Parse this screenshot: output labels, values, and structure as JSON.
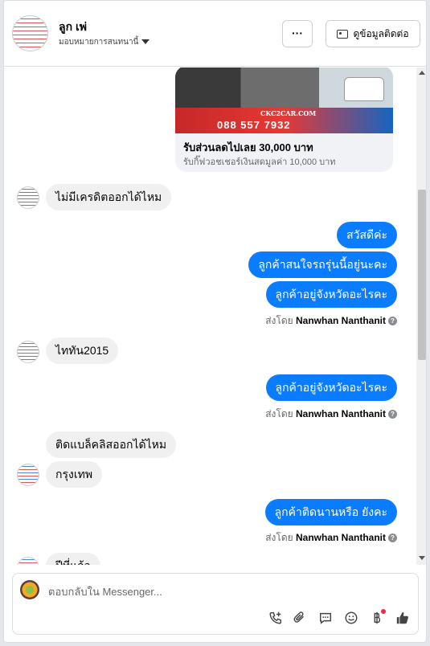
{
  "header": {
    "contact_name": "ลูก เพ่",
    "assign_label": "มอบหมายการสนทนานี้",
    "more_label": "···",
    "contact_info_label": "ดูข้อมูลติดต่อ"
  },
  "ad_card": {
    "site_text": "CKC2CAR.COM",
    "phone_text": "088 557 7932",
    "title": "รับส่วนลดไปเลย 30,000 บาท",
    "subtitle": "รับกิ๊ฟวอชเชอร์เงินสดมูลค่า 10,000 บาท"
  },
  "messages": {
    "m1": "ไม่มีเครดิตออกได้ไหม",
    "m2": "สวัสดีค่ะ",
    "m3": "ลูกค้าสนใจรถรุ่นนี้อยู่นะคะ",
    "m4": "ลูกค้าอยู่จังหวัดอะไรคะ",
    "m5": "ไททัน2015",
    "m6": "ลูกค้าอยู่จังหวัดอะไรคะ",
    "m7": "ติดแบล็คลิสออกได้ไหม",
    "m8": "กรุงเทพ",
    "m9": "ลูกค้าติดนานหรือ ยังคะ",
    "m10": "ปีที่แล้ว"
  },
  "sent_by": {
    "prefix": "ส่งโดย",
    "name": "Nanwhan Nanthanit"
  },
  "composer": {
    "placeholder": "ตอบกลับใน Messenger..."
  },
  "icons": [
    "phone-add-icon",
    "paperclip-icon",
    "saved-reply-icon",
    "emoji-icon",
    "baht-icon",
    "like-icon"
  ],
  "colors": {
    "outgoing_bubble": "#0a7cff",
    "incoming_bubble": "#f0f0f0",
    "notification_dot": "#f02849"
  }
}
